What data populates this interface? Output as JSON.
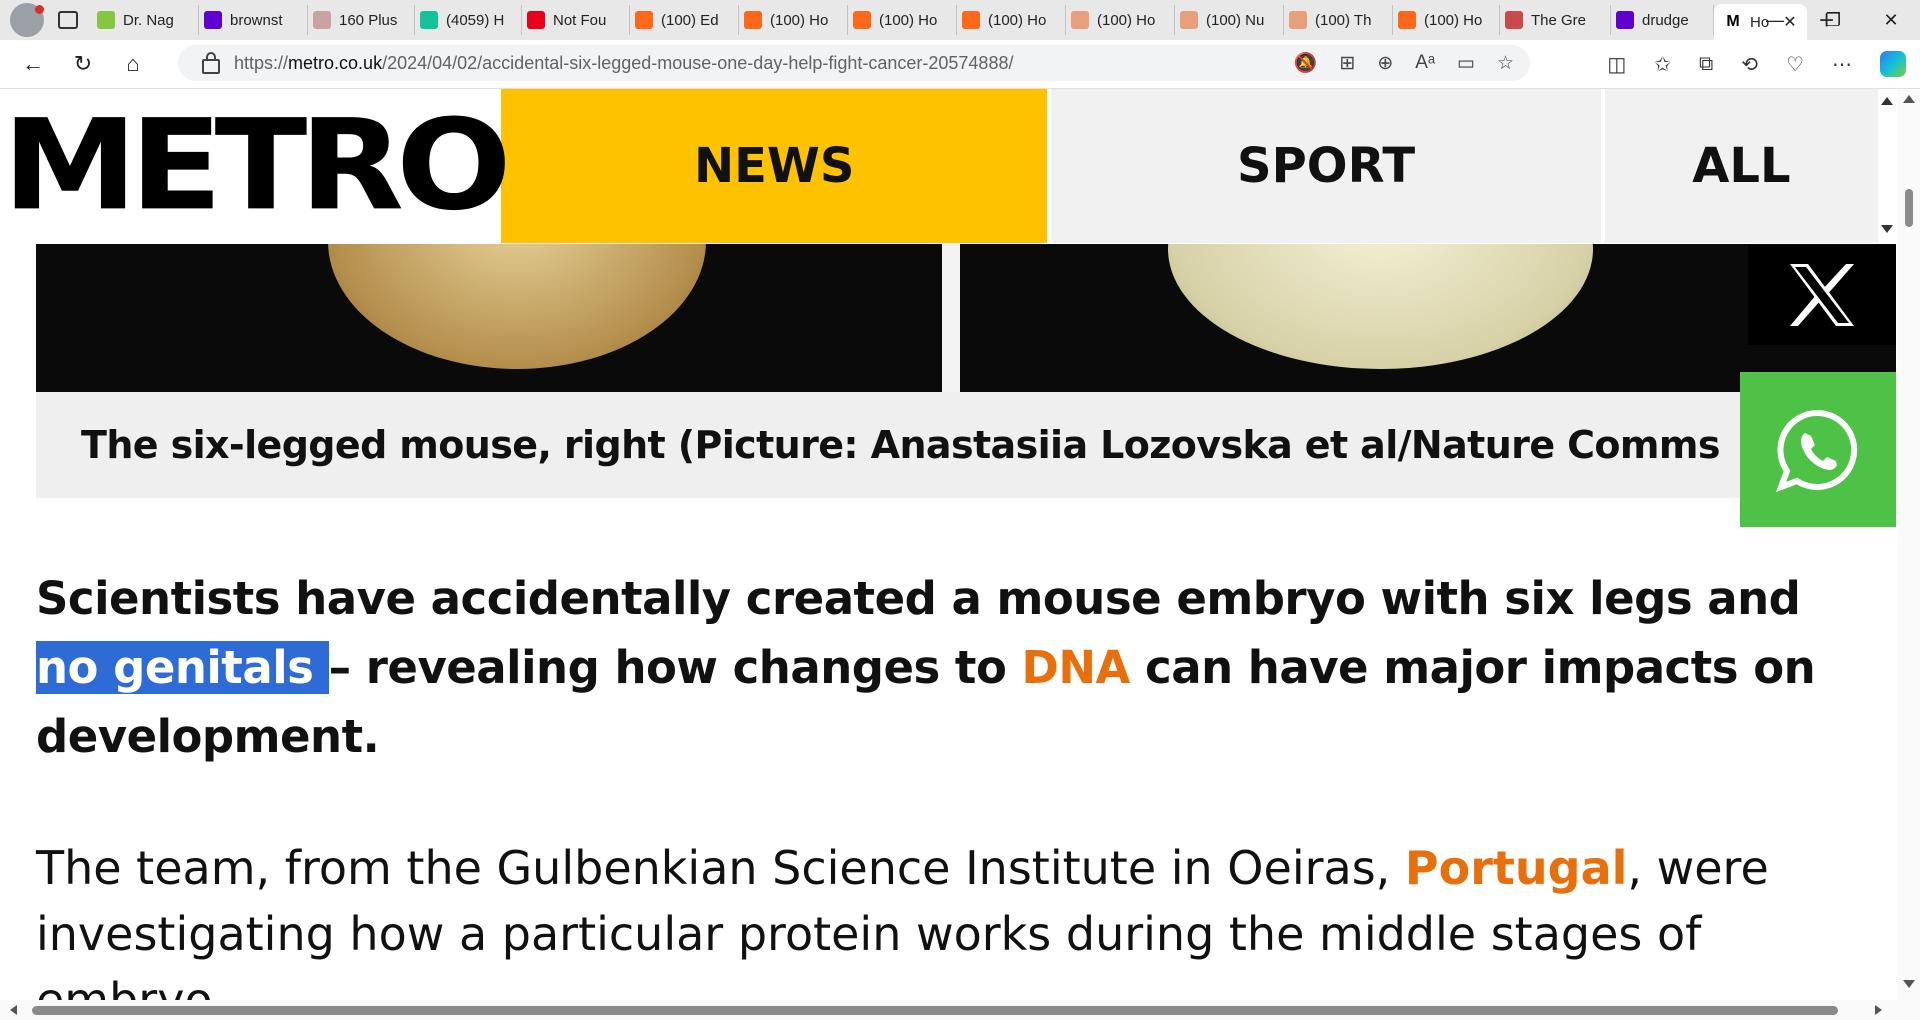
{
  "browser": {
    "tabs": [
      {
        "title": "Dr. Nag",
        "icon": "rumble-icon",
        "color": "#85c742"
      },
      {
        "title": "brownst",
        "icon": "yahoo-icon",
        "color": "#6001d2"
      },
      {
        "title": "160 Plus",
        "icon": "business-insider-icon",
        "color": "#c9a3a3"
      },
      {
        "title": "(4059) H",
        "icon": "grammarly-icon",
        "color": "#15c39a"
      },
      {
        "title": "Not Fou",
        "icon": "red-alert-icon",
        "color": "#e8001c"
      },
      {
        "title": "(100) Ed",
        "icon": "substack-icon",
        "color": "#ff6719"
      },
      {
        "title": "(100) Ho",
        "icon": "substack-icon",
        "color": "#ff6719"
      },
      {
        "title": "(100) Ho",
        "icon": "substack-icon",
        "color": "#ff6719"
      },
      {
        "title": "(100) Ho",
        "icon": "substack-icon",
        "color": "#ff6719"
      },
      {
        "title": "(100) Ho",
        "icon": "substack-icon",
        "color": "#e8a07a"
      },
      {
        "title": "(100) Nu",
        "icon": "substack-icon",
        "color": "#e8a07a"
      },
      {
        "title": "(100) Th",
        "icon": "substack-icon",
        "color": "#e8a07a"
      },
      {
        "title": "(100) Ho",
        "icon": "substack-icon",
        "color": "#ff6719"
      },
      {
        "title": "The Gre",
        "icon": "ds-icon",
        "color": "#c94a4a"
      },
      {
        "title": "drudge",
        "icon": "yahoo-icon",
        "color": "#6001d2"
      }
    ],
    "active_tab": {
      "title": "Ho",
      "icon": "metro-icon"
    },
    "url_prefix": "https://",
    "url_domain": "metro.co.uk",
    "url_path": "/2024/04/02/accidental-six-legged-mouse-one-day-help-fight-cancer-20574888/"
  },
  "site": {
    "logo": "METRO",
    "nav": {
      "news": "NEWS",
      "sport": "SPORT",
      "all": "ALL"
    },
    "colors": {
      "news_bg": "#ffc200",
      "link_orange": "#e8700c",
      "whatsapp": "#4dc247",
      "highlight": "#2e6bd6"
    }
  },
  "article": {
    "caption": "The six-legged mouse, right (Picture: Anastasiia Lozovska et al/Nature Comms",
    "lead": {
      "part1": "Scientists have accidentally created a mouse embryo with six legs and ",
      "highlight": "no genitals ",
      "part2": "– revealing how changes to ",
      "link": "DNA",
      "part3": " can have major impacts on development."
    },
    "body": {
      "part1": "The team, from the Gulbenkian Science Institute in Oeiras, ",
      "link": "Portugal",
      "part2": ", were investigating how a particular protein works during the middle stages of embryo"
    }
  }
}
